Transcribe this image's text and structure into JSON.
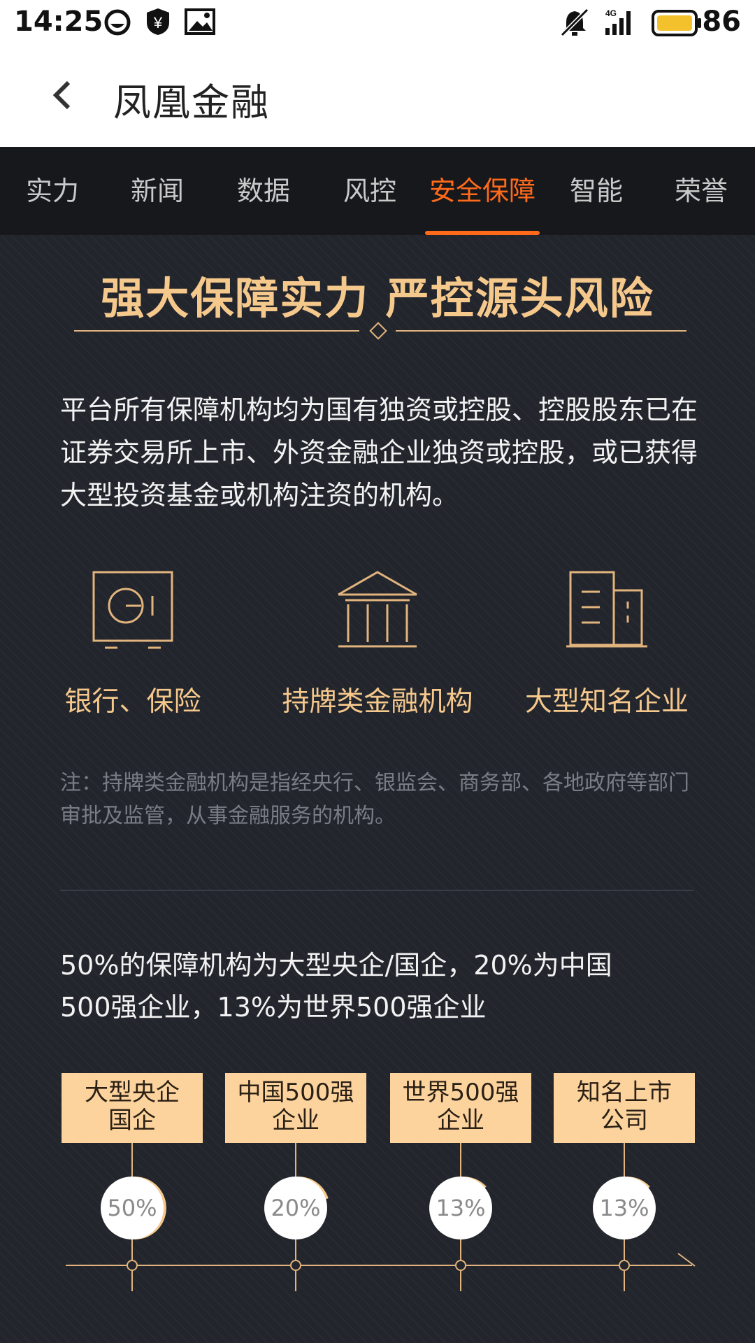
{
  "status_bar": {
    "time": "14:25",
    "battery_percent": "86",
    "icons": [
      "face-icon",
      "shield-yen-icon",
      "image-icon",
      "bell-off-icon",
      "signal-4g-icon",
      "battery-icon"
    ]
  },
  "app_bar": {
    "title": "凤凰金融",
    "back_icon": "chevron-left-icon"
  },
  "tabs": [
    {
      "label": "实力"
    },
    {
      "label": "新闻"
    },
    {
      "label": "数据"
    },
    {
      "label": "风控"
    },
    {
      "label": "安全保障",
      "active": true
    },
    {
      "label": "智能"
    },
    {
      "label": "荣誉"
    }
  ],
  "colors": {
    "accent": "#ff6a1a",
    "gold": "#f5c88c",
    "background": "#23252d",
    "box": "#fdd39d"
  },
  "section": {
    "headline": "强大保障实力 严控源头风险",
    "paragraph": "平台所有保障机构均为国有独资或控股、控股股东已在证券交易所上市、外资金融企业独资或控股，或已获得大型投资基金或机构注资的机构。",
    "features": [
      {
        "icon": "safe-icon",
        "label": "银行、保险"
      },
      {
        "icon": "bank-building-icon",
        "label": "持牌类金融机构"
      },
      {
        "icon": "office-building-icon",
        "label": "大型知名企业"
      }
    ],
    "note": "注：持牌类金融机构是指经央行、银监会、商务部、各地政府等部门审批及监管，从事金融服务的机构。",
    "stat_text_1": "50%的保障机构为大型央企/国企，20%为中国",
    "stat_text_2": "500强企业，13%为世界500强企业",
    "timeline": [
      {
        "line1": "大型央企",
        "line2": "国企",
        "percent": "50%",
        "value": 0.5
      },
      {
        "line1": "中国500强",
        "line2": "企业",
        "percent": "20%",
        "value": 0.2
      },
      {
        "line1": "世界500强",
        "line2": "企业",
        "percent": "13%",
        "value": 0.13
      },
      {
        "line1": "知名上市",
        "line2": "公司",
        "percent": "13%",
        "value": 0.13
      }
    ]
  }
}
